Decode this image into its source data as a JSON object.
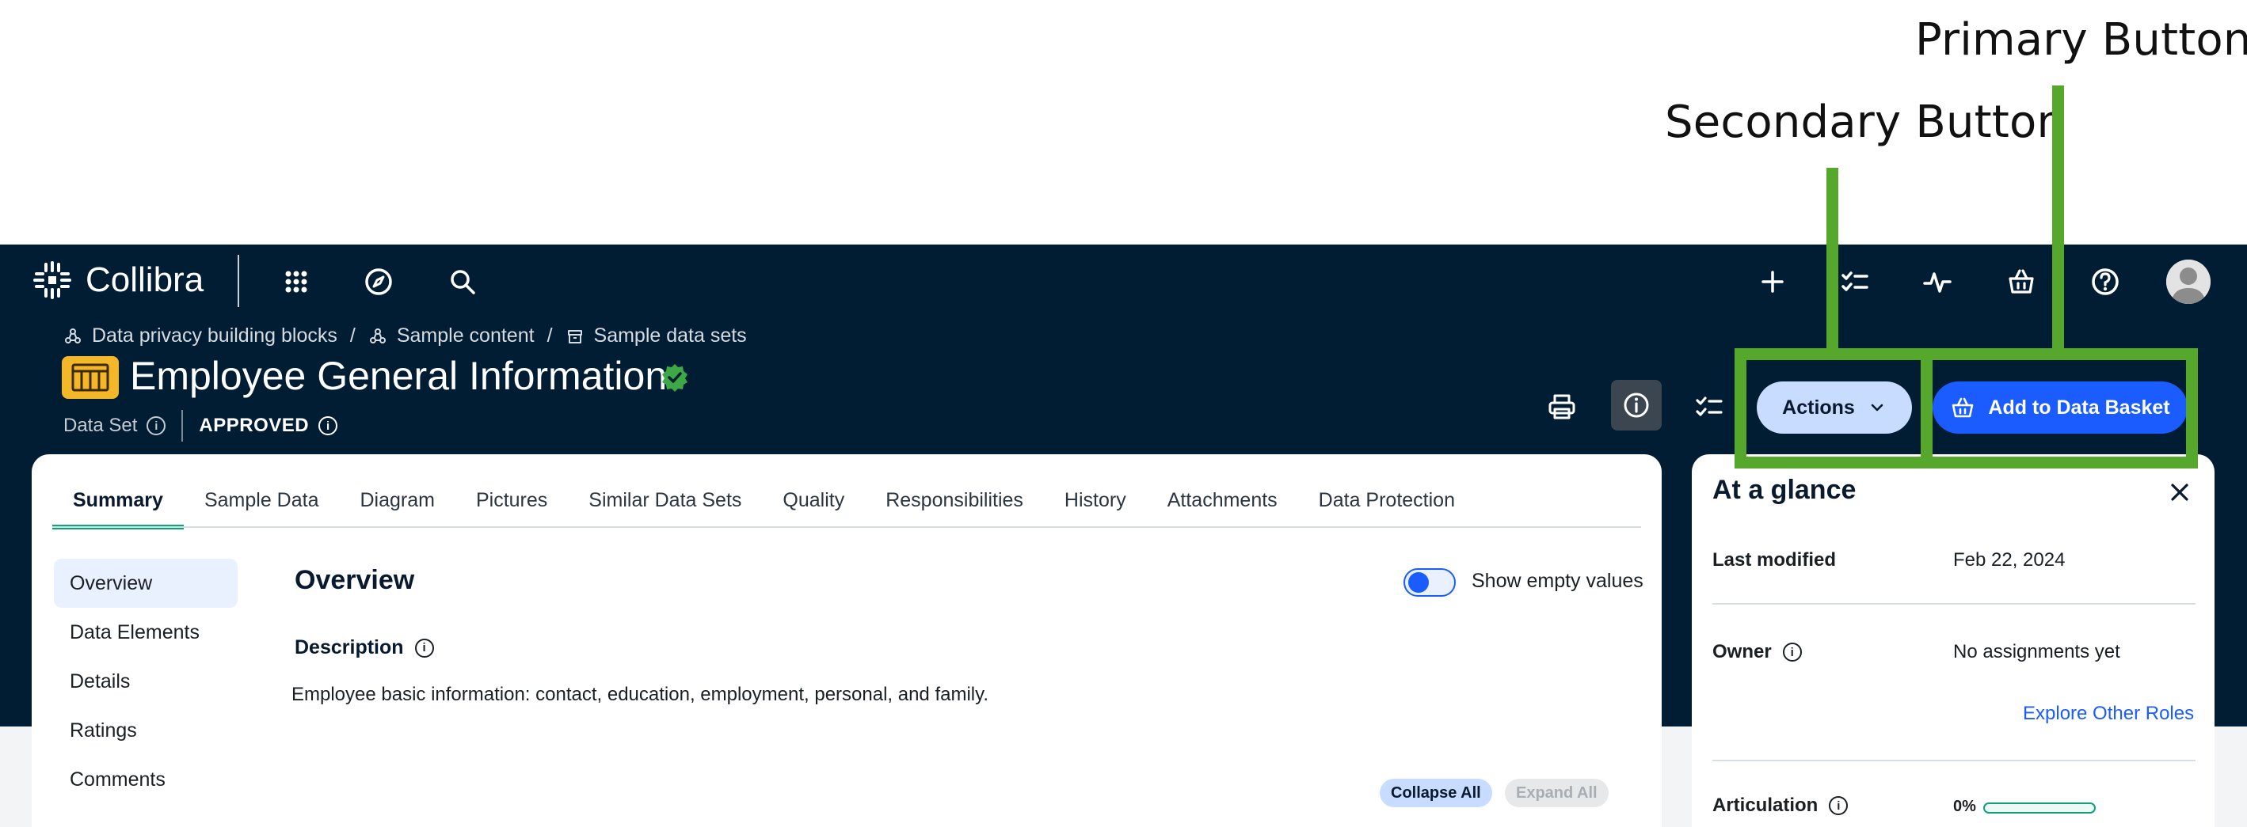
{
  "annotations": {
    "primary_label": "Primary Button",
    "secondary_label": "Secondary Button",
    "highlight_color": "#55a82b"
  },
  "app": {
    "brand": "Collibra",
    "nav_icons": [
      "apps-grid-icon",
      "compass-icon",
      "search-icon"
    ],
    "right_icons": [
      "plus-icon",
      "tasks-icon",
      "activity-icon",
      "basket-icon",
      "help-icon",
      "avatar"
    ]
  },
  "breadcrumb": {
    "items": [
      "Data privacy building blocks",
      "Sample content",
      "Sample data sets"
    ],
    "separator": "/"
  },
  "asset": {
    "title": "Employee General Information",
    "type": "Data Set",
    "status": "APPROVED",
    "type_color": "#f4b72a"
  },
  "header": {
    "actions_label": "Actions",
    "add_basket_label": "Add to Data Basket"
  },
  "tabs": [
    "Summary",
    "Sample Data",
    "Diagram",
    "Pictures",
    "Similar Data Sets",
    "Quality",
    "Responsibilities",
    "History",
    "Attachments",
    "Data Protection"
  ],
  "active_tab": "Summary",
  "sidenav": [
    "Overview",
    "Data Elements",
    "Details",
    "Ratings",
    "Comments"
  ],
  "overview": {
    "title": "Overview",
    "toggle_label": "Show empty values",
    "toggle_on": true,
    "description_label": "Description",
    "description": "Employee basic information: contact, education, employment, personal, and family.",
    "collapse_label": "Collapse All",
    "expand_label": "Expand All"
  },
  "glance": {
    "title": "At a glance",
    "last_modified_label": "Last modified",
    "last_modified_value": "Feb 22, 2024",
    "owner_label": "Owner",
    "owner_value": "No assignments yet",
    "explore_link": "Explore Other Roles",
    "articulation_label": "Articulation",
    "articulation_value": "0%",
    "articulation_fraction": 0.0
  },
  "colors": {
    "nav_bg": "#011d33",
    "accent_blue": "#1a5cff",
    "secondary_bg": "#c8dcff",
    "success_green": "#0ca37c"
  }
}
